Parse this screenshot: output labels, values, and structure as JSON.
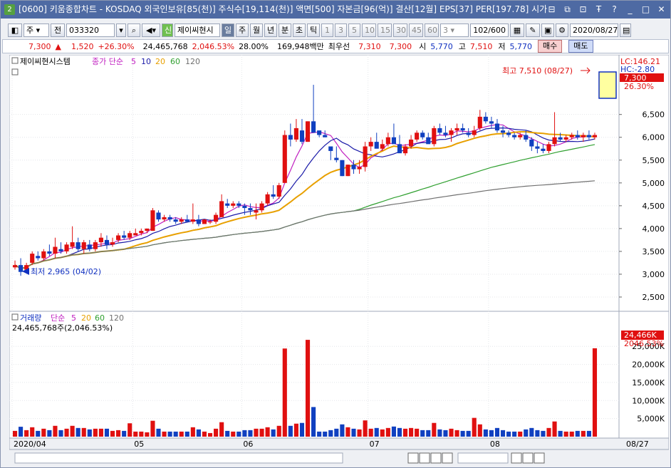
{
  "title": {
    "num": "2",
    "text": "[0600] 키움종합차트 - KOSDAQ 외국인보유[85(천)] 주식수[19,114(천)] 액면[500] 자본금[96(억)] 결산[12월] EPS[37] PER[197.78] 시가"
  },
  "toolbar": {
    "market": "주",
    "prev": "전",
    "code": "033320",
    "shin": "신",
    "name": "제이씨현시",
    "periods": [
      "일",
      "주",
      "월",
      "년",
      "분",
      "초",
      "틱"
    ],
    "selected_period": "일",
    "minutes": [
      "1",
      "3",
      "5",
      "10",
      "15",
      "30",
      "45",
      "60"
    ],
    "custom": "3",
    "count": "102/600",
    "date": "2020/08/27"
  },
  "quote": {
    "price": "7,300",
    "arrow": "▲",
    "change": "1,520",
    "rate": "+26.30%",
    "volume": "24,465,768",
    "vol_rate": "2,046.53%",
    "turnover": "28.00%",
    "amount": "169,948백만",
    "priority_label": "최우선",
    "ask": "7,310",
    "bid": "7,300",
    "open_label": "시",
    "open": "5,770",
    "high_label": "고",
    "high": "7,510",
    "low_label": "저",
    "low": "5,770",
    "buy_label": "매수",
    "sell_label": "매도"
  },
  "price_legend": {
    "name": "제이씨현시스템",
    "ma_label": "종가 단순",
    "ma": [
      {
        "p": "5",
        "c": "#c020c0"
      },
      {
        "p": "10",
        "c": "#1a1aa8"
      },
      {
        "p": "20",
        "c": "#e8a000"
      },
      {
        "p": "60",
        "c": "#30a030"
      },
      {
        "p": "120",
        "c": "#707070"
      }
    ]
  },
  "vol_legend": {
    "name": "거래량",
    "ma_label": "단순",
    "ma": [
      {
        "p": "5",
        "c": "#c020c0"
      },
      {
        "p": "20",
        "c": "#e8a000"
      },
      {
        "p": "60",
        "c": "#30a030"
      },
      {
        "p": "120",
        "c": "#707070"
      }
    ],
    "info": "24,465,768주(2,046.53%)"
  },
  "price_axis": {
    "lc": "LC:146.21",
    "hc": "HC:-2.80",
    "current": "7,300",
    "current_rate": "26.30%",
    "ticks": [
      "6,500",
      "6,000",
      "5,500",
      "5,000",
      "4,500",
      "4,000",
      "3,500",
      "3,000",
      "2,500"
    ]
  },
  "vol_axis": {
    "current": "24,466K",
    "rate": "2046.53%",
    "ticks": [
      "25,000K",
      "20,000K",
      "15,000K",
      "10,000K",
      "5,000K"
    ]
  },
  "annotations": {
    "high": "최고 7,510 (08/27)",
    "low": "최저 2,965 (04/02)"
  },
  "x_axis": {
    "labels": [
      "2020/04",
      "05",
      "06",
      "07",
      "08"
    ],
    "last": "08/27"
  },
  "colors": {
    "up": "#e01010",
    "down": "#1040c0",
    "ma5": "#c020c0",
    "ma10": "#1a1aa8",
    "ma20": "#e8a000",
    "ma60": "#30a030",
    "ma120": "#707070"
  },
  "chart_data": {
    "type": "candlestick",
    "x_start": "2020/04/01",
    "x_end": "2020/08/27",
    "ylim": [
      2250,
      7650
    ],
    "candles": [
      [
        3150,
        3300,
        3100,
        3200
      ],
      [
        3200,
        3350,
        2965,
        3050
      ],
      [
        3100,
        3250,
        3050,
        3200
      ],
      [
        3250,
        3500,
        3200,
        3450
      ],
      [
        3400,
        3500,
        3300,
        3350
      ],
      [
        3350,
        3550,
        3300,
        3500
      ],
      [
        3500,
        3650,
        3400,
        3450
      ],
      [
        3450,
        3800,
        3350,
        3600
      ],
      [
        3550,
        3700,
        3450,
        3500
      ],
      [
        3500,
        3700,
        3450,
        3650
      ],
      [
        3600,
        4050,
        3550,
        3700
      ],
      [
        3700,
        3800,
        3500,
        3550
      ],
      [
        3550,
        3750,
        3450,
        3700
      ],
      [
        3650,
        3750,
        3500,
        3550
      ],
      [
        3550,
        3750,
        3500,
        3700
      ],
      [
        3700,
        3900,
        3600,
        3800
      ],
      [
        3750,
        3850,
        3550,
        3650
      ],
      [
        3650,
        3800,
        3600,
        3700
      ],
      [
        3750,
        3900,
        3700,
        3850
      ],
      [
        3850,
        3950,
        3750,
        3800
      ],
      [
        3800,
        3950,
        3750,
        3900
      ],
      [
        3850,
        4000,
        3850,
        3900
      ],
      [
        3900,
        4000,
        3850,
        3950
      ],
      [
        3950,
        4000,
        3900,
        4000
      ],
      [
        3950,
        4450,
        3950,
        4400
      ],
      [
        4350,
        4400,
        4150,
        4200
      ],
      [
        4200,
        4300,
        4150,
        4250
      ],
      [
        4250,
        4300,
        4150,
        4200
      ],
      [
        4200,
        4250,
        4100,
        4150
      ],
      [
        4150,
        4250,
        4100,
        4200
      ],
      [
        4200,
        4300,
        4150,
        4150
      ],
      [
        4150,
        4550,
        4100,
        4200
      ],
      [
        4200,
        4300,
        4050,
        4100
      ],
      [
        4100,
        4200,
        4100,
        4200
      ],
      [
        4150,
        4200,
        4100,
        4150
      ],
      [
        4150,
        4350,
        4100,
        4300
      ],
      [
        4250,
        4750,
        4250,
        4600
      ],
      [
        4550,
        4650,
        4450,
        4500
      ],
      [
        4500,
        4600,
        4450,
        4550
      ],
      [
        4550,
        4600,
        4450,
        4500
      ],
      [
        4500,
        4550,
        4300,
        4450
      ],
      [
        4450,
        4550,
        4300,
        4400
      ],
      [
        4350,
        4550,
        4200,
        4400
      ],
      [
        4400,
        4600,
        4350,
        4550
      ],
      [
        4550,
        4800,
        4500,
        4750
      ],
      [
        4750,
        4950,
        4650,
        4700
      ],
      [
        4700,
        5000,
        4650,
        4950
      ],
      [
        5000,
        6150,
        5000,
        6050
      ],
      [
        6050,
        6300,
        5800,
        5950
      ],
      [
        5950,
        6400,
        5900,
        6200
      ],
      [
        6150,
        6400,
        5850,
        5900
      ],
      [
        5900,
        6350,
        5900,
        6350
      ],
      [
        6350,
        7150,
        6250,
        6100
      ],
      [
        6150,
        6100,
        6000,
        6050
      ],
      [
        6050,
        6150,
        6000,
        6000
      ],
      [
        5800,
        5700,
        5500,
        5700
      ],
      [
        5550,
        5800,
        5450,
        5500
      ],
      [
        5500,
        5500,
        5150,
        5150
      ],
      [
        5150,
        5400,
        5150,
        5400
      ],
      [
        5400,
        5500,
        5200,
        5300
      ],
      [
        5300,
        5500,
        5200,
        5350
      ],
      [
        5350,
        5900,
        5250,
        5800
      ],
      [
        5800,
        6000,
        5700,
        5900
      ],
      [
        5900,
        6100,
        5800,
        5750
      ],
      [
        5750,
        5950,
        5700,
        5850
      ],
      [
        5850,
        6100,
        5800,
        6000
      ],
      [
        6000,
        6300,
        5900,
        5850
      ],
      [
        5850,
        6050,
        5800,
        5650
      ],
      [
        5650,
        5850,
        5600,
        5800
      ],
      [
        5800,
        6050,
        5750,
        5950
      ],
      [
        5950,
        6150,
        5900,
        6100
      ],
      [
        6100,
        6150,
        5950,
        6000
      ],
      [
        6000,
        6100,
        5950,
        5850
      ],
      [
        5850,
        6250,
        5800,
        6200
      ],
      [
        6200,
        6300,
        6050,
        6100
      ],
      [
        6100,
        6250,
        6000,
        6050
      ],
      [
        6050,
        6200,
        5900,
        6150
      ],
      [
        6150,
        6300,
        6050,
        6200
      ],
      [
        6200,
        6300,
        6100,
        6150
      ],
      [
        6100,
        6200,
        6000,
        6050
      ],
      [
        6050,
        6250,
        6000,
        6150
      ],
      [
        6200,
        6600,
        6150,
        6450
      ],
      [
        6450,
        6550,
        6300,
        6350
      ],
      [
        6350,
        6450,
        6200,
        6300
      ],
      [
        6300,
        6400,
        6100,
        6150
      ],
      [
        6150,
        6250,
        6000,
        6100
      ],
      [
        6100,
        6150,
        6000,
        6050
      ],
      [
        6050,
        6100,
        5950,
        6000
      ],
      [
        6000,
        6100,
        5950,
        6050
      ],
      [
        6050,
        6150,
        5900,
        5950
      ],
      [
        5950,
        6000,
        5700,
        5800
      ],
      [
        5800,
        5900,
        5650,
        5750
      ],
      [
        5750,
        5850,
        5650,
        5700
      ],
      [
        5700,
        5900,
        5650,
        5850
      ],
      [
        5850,
        6550,
        5800,
        6000
      ],
      [
        6000,
        6100,
        5900,
        5950
      ],
      [
        5950,
        6050,
        5900,
        6000
      ],
      [
        6000,
        6100,
        5950,
        6050
      ],
      [
        6050,
        6150,
        5950,
        6000
      ],
      [
        6000,
        6100,
        5900,
        6050
      ],
      [
        6050,
        6150,
        5950,
        6000
      ],
      [
        6000,
        6100,
        5950,
        6050
      ],
      [
        6050,
        6150,
        5950,
        6000
      ],
      [
        6000,
        6100,
        5950,
        6050
      ],
      [
        6050,
        6100,
        5950,
        6000
      ],
      [
        6000,
        6100,
        5950,
        6050
      ],
      [
        6050,
        6100,
        5950,
        6000
      ],
      [
        6000,
        6100,
        5950,
        6050
      ],
      [
        6050,
        6100,
        5950,
        6000
      ],
      [
        6000,
        6100,
        5950,
        6050
      ],
      [
        6050,
        6100,
        5950,
        6000
      ],
      [
        6000,
        6100,
        5950,
        6050
      ],
      [
        6050,
        6100,
        5950,
        6000
      ],
      [
        6000,
        6100,
        5950,
        6050
      ],
      [
        6050,
        6100,
        5950,
        6000
      ],
      [
        6000,
        6100,
        5950,
        6050
      ],
      [
        6050,
        6100,
        5950,
        6000
      ],
      [
        6000,
        6100,
        5950,
        6050
      ],
      [
        6050,
        6100,
        5950,
        6000
      ],
      [
        6000,
        6100,
        5950,
        6050
      ],
      [
        6050,
        6100,
        5950,
        6000
      ],
      [
        6000,
        6100,
        5950,
        6050
      ],
      [
        6050,
        6100,
        5950,
        6000
      ],
      [
        6000,
        6100,
        5950,
        6050
      ],
      [
        6050,
        6100,
        5950,
        6000
      ],
      [
        6000,
        6100,
        5950,
        6050
      ],
      [
        6050,
        6100,
        5950,
        6000
      ],
      [
        6000,
        6100,
        5950,
        6050
      ],
      [
        6050,
        6100,
        5950,
        6000
      ],
      [
        6000,
        6100,
        5950,
        6050
      ],
      [
        6050,
        6100,
        5950,
        6000
      ],
      [
        6000,
        6100,
        5950,
        6050
      ],
      [
        6050,
        6100,
        5950,
        6000
      ],
      [
        6000,
        6100,
        5950,
        6050
      ],
      [
        6050,
        6100,
        5950,
        6000
      ],
      [
        6000,
        6100,
        5950,
        6050
      ],
      [
        6050,
        6100,
        5950,
        6000
      ],
      [
        6000,
        6100,
        5950,
        6050
      ],
      [
        6050,
        6100,
        5950,
        6000
      ],
      [
        6000,
        6100,
        5950,
        6050
      ],
      [
        6050,
        6100,
        5950,
        6000
      ],
      [
        6000,
        6100,
        5950,
        6050
      ],
      [
        6050,
        6100,
        5950,
        6000
      ]
    ]
  }
}
